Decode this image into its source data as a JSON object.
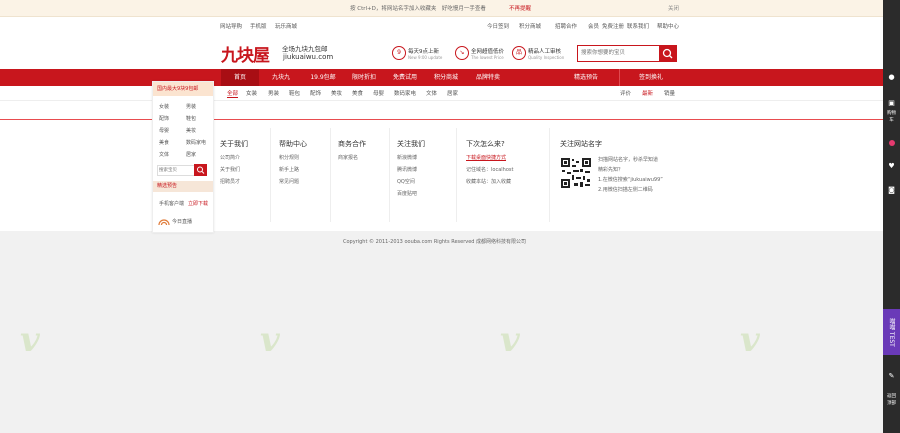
{
  "notice": {
    "message": "按 Ctrl+D，将网站名字加入收藏夹　好吃慢月一手查看",
    "stop": "不再提醒",
    "close": "关闭"
  },
  "toplinks": {
    "items": [
      "网站导购",
      "手机版",
      "玩乐商城"
    ],
    "right": [
      "今日签到",
      "积分商城",
      "招聘合作",
      "会员",
      "免费注册",
      "联系我们",
      "帮助中心"
    ]
  },
  "header": {
    "logo": "九块屋",
    "tagline": "全场九块九包邮",
    "url": "jiukuaiwu.com",
    "features": [
      {
        "title": "每天9点上新",
        "sub": "New 9:00 update"
      },
      {
        "title": "全网超值低价",
        "sub": "The lowest Price"
      },
      {
        "title": "精品人工审核",
        "sub": "Quality Inspection"
      }
    ],
    "search_placeholder": "搜索你想要的宝贝"
  },
  "nav": {
    "items": [
      "首页",
      "九块九",
      "19.9包邮",
      "限时折扣",
      "免费试用",
      "积分商城",
      "品牌特卖"
    ],
    "right": "精选预告",
    "signin": "签到换礼"
  },
  "categories": {
    "items": [
      "全部",
      "女装",
      "男装",
      "鞋包",
      "配饰",
      "美妆",
      "美食",
      "母婴",
      "数码家电",
      "文体",
      "居家"
    ],
    "sort": [
      "评价",
      "最新",
      "销量"
    ]
  },
  "footer": {
    "columns": [
      {
        "title": "关于我们",
        "links": [
          "公司简介",
          "关于我们",
          "招聘员才"
        ]
      },
      {
        "title": "帮助中心",
        "links": [
          "积分规则",
          "新手上路",
          "常见问题"
        ]
      },
      {
        "title": "商务合作",
        "links": [
          "商家报名"
        ]
      },
      {
        "title": "关注我们",
        "links": [
          "新浪微博",
          "腾讯微博",
          "QQ空间",
          "百度贴吧"
        ]
      },
      {
        "title": "下次怎么来?",
        "links": [
          "下载桌面快捷方式",
          "记住域名：localhost",
          "收藏本站：加入收藏"
        ]
      }
    ],
    "follow": {
      "title": "关注网站名字",
      "lines": [
        "扫描网站名字，秒杀早知道",
        "精彩先知？",
        "1.在微信搜索“jiukuaiwu99”",
        "2.用微信扫描左侧二维码"
      ]
    },
    "copyright": "Copyright © 2011-2013 oouba.com  Rights Reserved  成都网络科技有限公司"
  },
  "left_sidebar": {
    "header": "国内最大9块9包邮",
    "grid": [
      [
        "女装",
        "男装"
      ],
      [
        "配饰",
        "鞋包"
      ],
      [
        "母婴",
        "美妆"
      ],
      [
        "美食",
        "数码家电"
      ],
      [
        "文体",
        "居家"
      ]
    ],
    "search_placeholder": "搜索宝贝",
    "strip": "精选预告",
    "app": "手机客户端",
    "app_link": "立即下载",
    "extra": "今日直播"
  },
  "right_toolbar": {
    "labels": [
      "我的",
      "购物车",
      "收藏",
      "足迹"
    ],
    "test": "喵喵 TEST",
    "bottom": [
      "反馈",
      "返回顶部"
    ]
  },
  "colors": {
    "brand": "#c8161d",
    "nav_active": "#a80e14",
    "test": "#6a3ab8"
  }
}
